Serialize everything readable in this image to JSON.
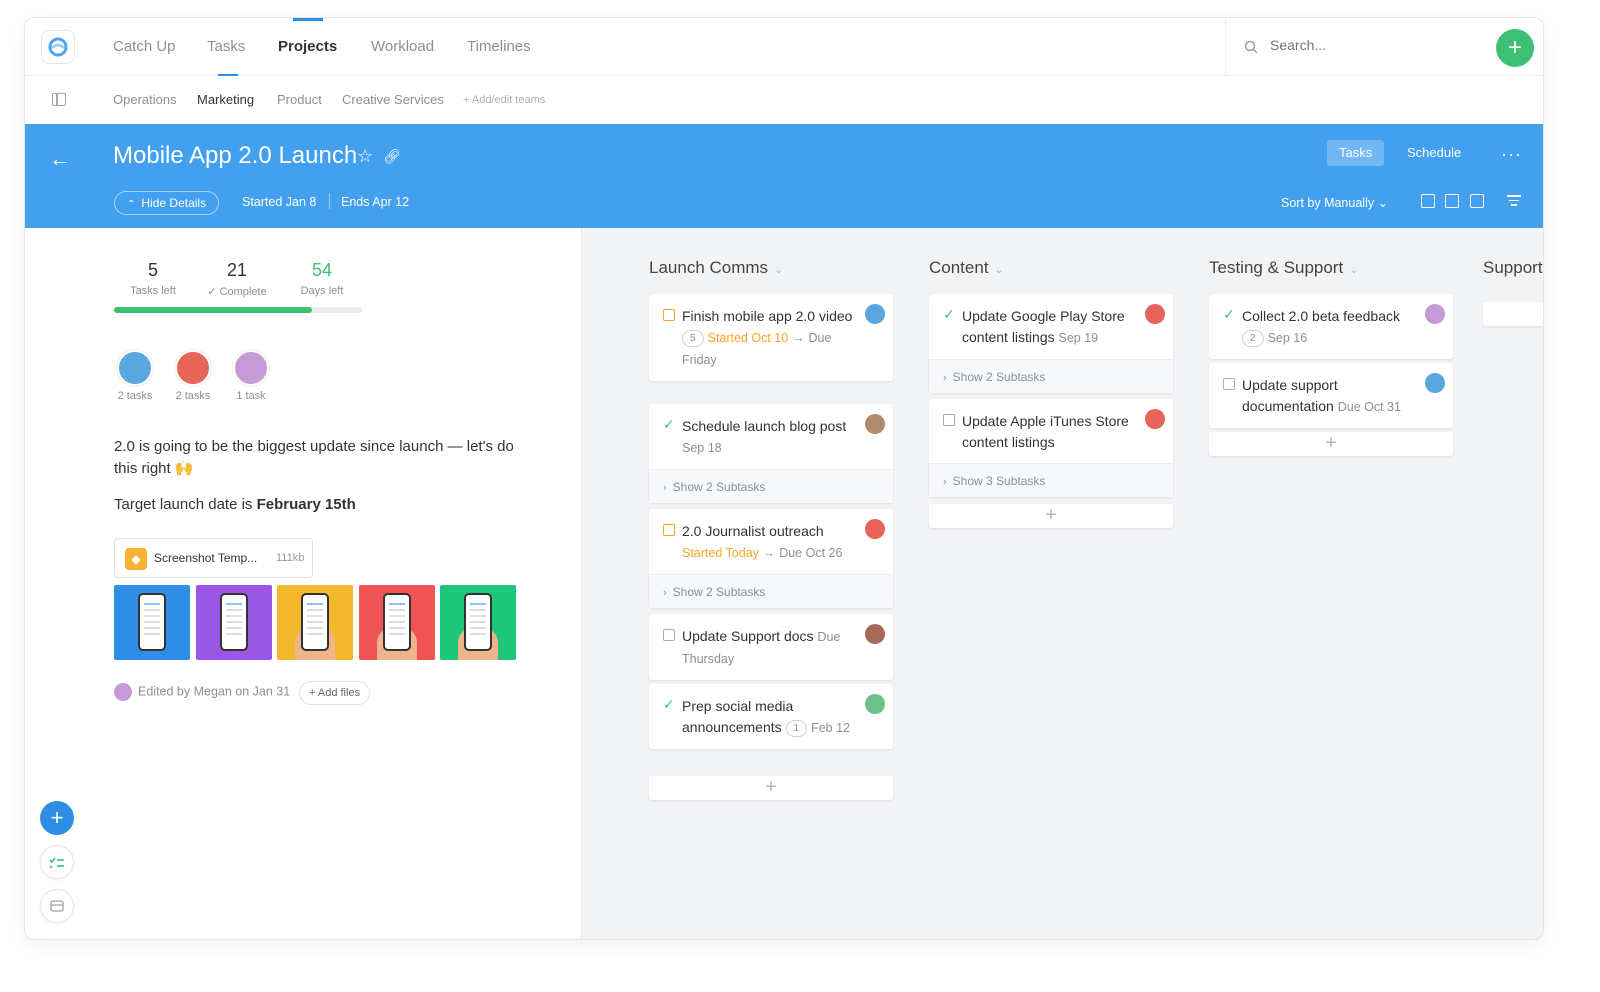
{
  "nav": {
    "tabs": [
      "Catch Up",
      "Tasks",
      "Projects",
      "Workload",
      "Timelines"
    ],
    "active_tab": "Projects",
    "search_placeholder": "Search...",
    "add_label": "+"
  },
  "teams": {
    "items": [
      "Operations",
      "Marketing",
      "Product",
      "Creative Services"
    ],
    "active": "Marketing",
    "add_edit": "+ Add/edit teams"
  },
  "project": {
    "back_icon": "arrow-left-icon",
    "title": "Mobile App 2.0 Launch",
    "hide_details": "Hide Details",
    "started": "Started Jan 8",
    "ends": "Ends Apr 12",
    "view_tabs": [
      "Tasks",
      "Schedule"
    ],
    "active_view": "Tasks",
    "more": "···",
    "sort": "Sort by Manually"
  },
  "stats": [
    {
      "value": "5",
      "label": "Tasks left"
    },
    {
      "value": "21",
      "label": "✓ Complete"
    },
    {
      "value": "54",
      "label": "Days left"
    }
  ],
  "progress_fraction": 0.8,
  "members": [
    {
      "label": "2 tasks",
      "color": "#5aa7e0"
    },
    {
      "label": "2 tasks",
      "color": "#e8635a"
    },
    {
      "label": "1 task",
      "color": "#c69ad6"
    }
  ],
  "description": "2.0 is going to be the biggest update since launch — let's do this right 🙌",
  "target_prefix": "Target launch date is ",
  "target_date": "February 15th",
  "file": {
    "name": "Screenshot Temp...",
    "size": "111kb"
  },
  "thumb_colors": [
    "#2f8fe6",
    "#9a57e6",
    "#f4b82c",
    "#ef5454",
    "#1ec67a"
  ],
  "edited_by": "Edited by Megan on Jan 31",
  "add_files": "+ Add files",
  "columns": [
    {
      "title": "Launch Comms",
      "cards": [
        {
          "state": "started",
          "title": "Finish mobile app 2.0 video",
          "badge": "5",
          "status": "Started Oct 10",
          "arrow": "→",
          "due": "Due Friday",
          "avatar": "#5aa7e0"
        },
        {
          "state": "done",
          "title": "Schedule launch blog post",
          "date": "Sep 18",
          "subtasks": "Show 2 Subtasks",
          "avatar": "#b08a6a"
        },
        {
          "state": "started",
          "title": "2.0 Journalist outreach",
          "status": "Started Today",
          "arrow": "→",
          "due": "Due Oct 26",
          "subtasks": "Show 2 Subtasks",
          "avatar": "#e8635a"
        },
        {
          "state": "open",
          "title": "Update Support docs",
          "due": "Due Thursday",
          "avatar": "#a86a58"
        },
        {
          "state": "done",
          "title": "Prep social media announcements",
          "badge": "1",
          "date": "Feb 12",
          "avatar": "#6fbf8a"
        }
      ]
    },
    {
      "title": "Content",
      "cards": [
        {
          "state": "done",
          "title": "Update Google Play Store content listings",
          "date": "Sep 19",
          "subtasks": "Show 2 Subtasks",
          "avatar": "#e8635a"
        },
        {
          "state": "open",
          "title": "Update Apple iTunes Store content listings",
          "subtasks": "Show 3 Subtasks",
          "avatar": "#e8635a"
        }
      ]
    },
    {
      "title": "Testing & Support",
      "cards": [
        {
          "state": "done",
          "title": "Collect 2.0 beta feedback",
          "badge": "2",
          "date": "Sep 16",
          "avatar": "#c69ad6"
        },
        {
          "state": "open",
          "title": "Update support documentation",
          "due": "Due Oct 31",
          "avatar": "#5aa7e0"
        }
      ]
    },
    {
      "title": "Support",
      "cards": []
    }
  ],
  "add_card": "+",
  "colors": {
    "accent": "#42a0ee",
    "green": "#3dc074",
    "orange": "#f6a523"
  }
}
